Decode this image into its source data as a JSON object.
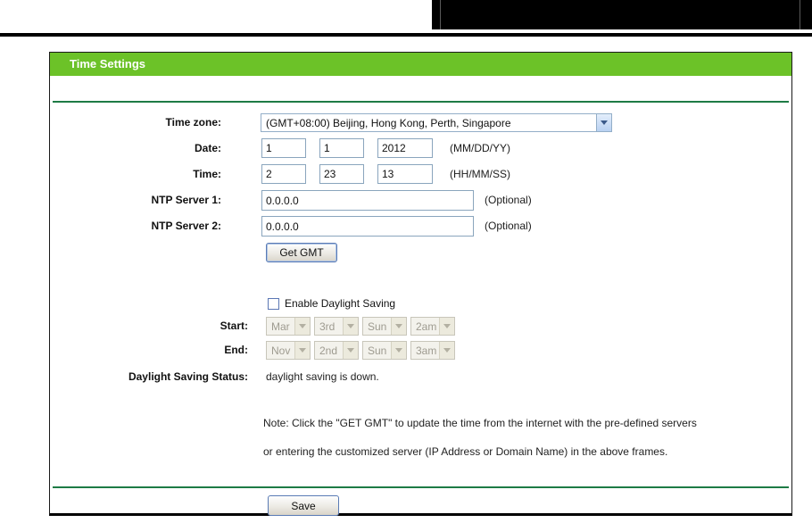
{
  "panel": {
    "header": "Time Settings",
    "time_zone": {
      "label": "Time zone:",
      "selected": "(GMT+08:00) Beijing, Hong Kong, Perth, Singapore"
    },
    "date": {
      "label": "Date:",
      "month": "1",
      "day": "1",
      "year": "2012",
      "hint": "(MM/DD/YY)"
    },
    "time": {
      "label": "Time:",
      "hour": "2",
      "minute": "23",
      "second": "13",
      "hint": "(HH/MM/SS)"
    },
    "ntp1": {
      "label": "NTP Server 1:",
      "value": "0.0.0.0",
      "hint": "(Optional)"
    },
    "ntp2": {
      "label": "NTP Server 2:",
      "value": "0.0.0.0",
      "hint": "(Optional)"
    },
    "get_gmt_label": "Get GMT",
    "daylight": {
      "checkbox_label": "Enable Daylight Saving",
      "checked": false,
      "start": {
        "label": "Start:",
        "month": "Mar",
        "week": "3rd",
        "day": "Sun",
        "time": "2am"
      },
      "end": {
        "label": "End:",
        "month": "Nov",
        "week": "2nd",
        "day": "Sun",
        "time": "3am"
      },
      "status_label": "Daylight Saving Status:",
      "status_value": "daylight saving is down."
    },
    "note_line1": "Note: Click the \"GET GMT\" to update the time from the internet with the pre-defined servers",
    "note_line2": "or entering the customized server (IP Address or Domain Name) in the above frames.",
    "save_label": "Save"
  },
  "colors": {
    "header_green": "#6CC228",
    "separator_green": "#1E7B45",
    "input_border_blue": "#8aa5bd",
    "button_border_blue": "#5a7bb5",
    "disabled_text": "#9e9b90"
  }
}
